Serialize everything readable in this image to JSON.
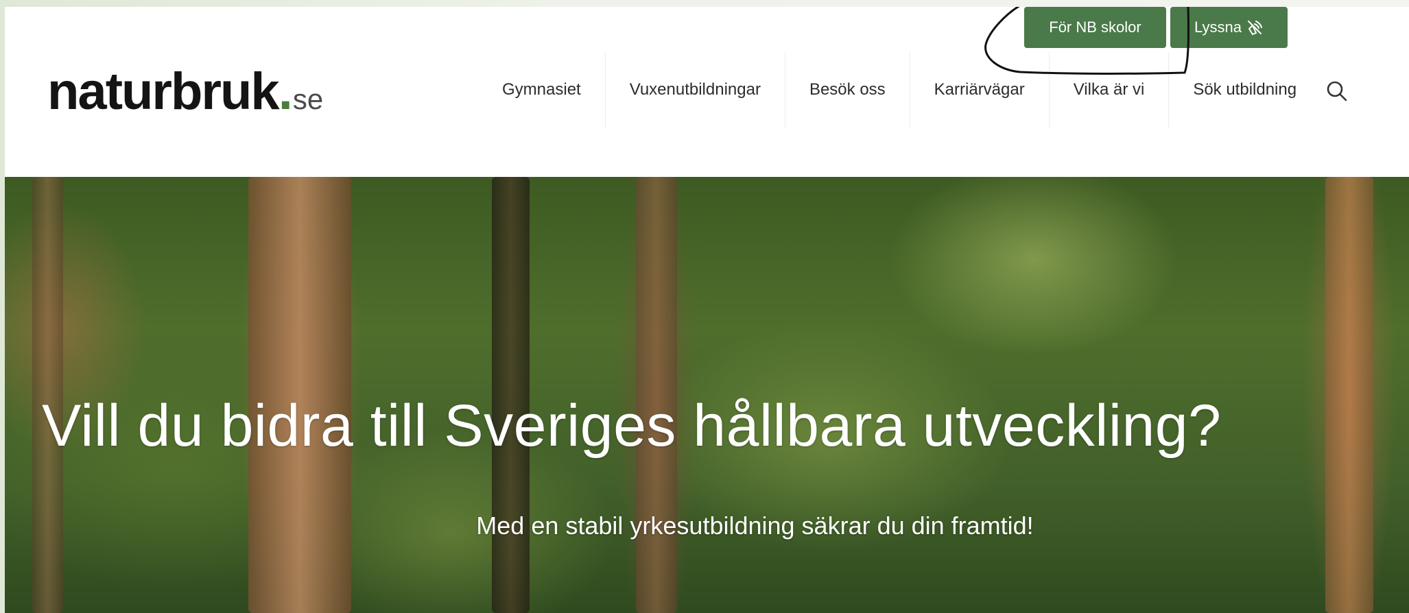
{
  "header": {
    "logo": {
      "main": "naturbruk",
      "dot": ".",
      "tld": "se"
    },
    "top_buttons": {
      "schools_label": "För NB skolor",
      "listen_label": "Lyssna",
      "listen_icon": "speaker-wave-icon"
    },
    "nav": {
      "items": [
        {
          "label": "Gymnasiet"
        },
        {
          "label": "Vuxenutbildningar"
        },
        {
          "label": "Besök oss"
        },
        {
          "label": "Karriärvägar"
        },
        {
          "label": "Vilka är vi"
        },
        {
          "label": "Sök utbildning"
        }
      ],
      "search_icon": "search-icon"
    }
  },
  "hero": {
    "title": "Vill du bidra till Sveriges hållbara utveckling?",
    "subtitle": "Med en stabil yrkesutbildning säkrar du din framtid!"
  },
  "colors": {
    "brand_green": "#4a7a49",
    "logo_text": "#141414",
    "nav_text": "#2c2c2c",
    "hero_text": "#ffffff",
    "annotation_ink": "#111111"
  }
}
